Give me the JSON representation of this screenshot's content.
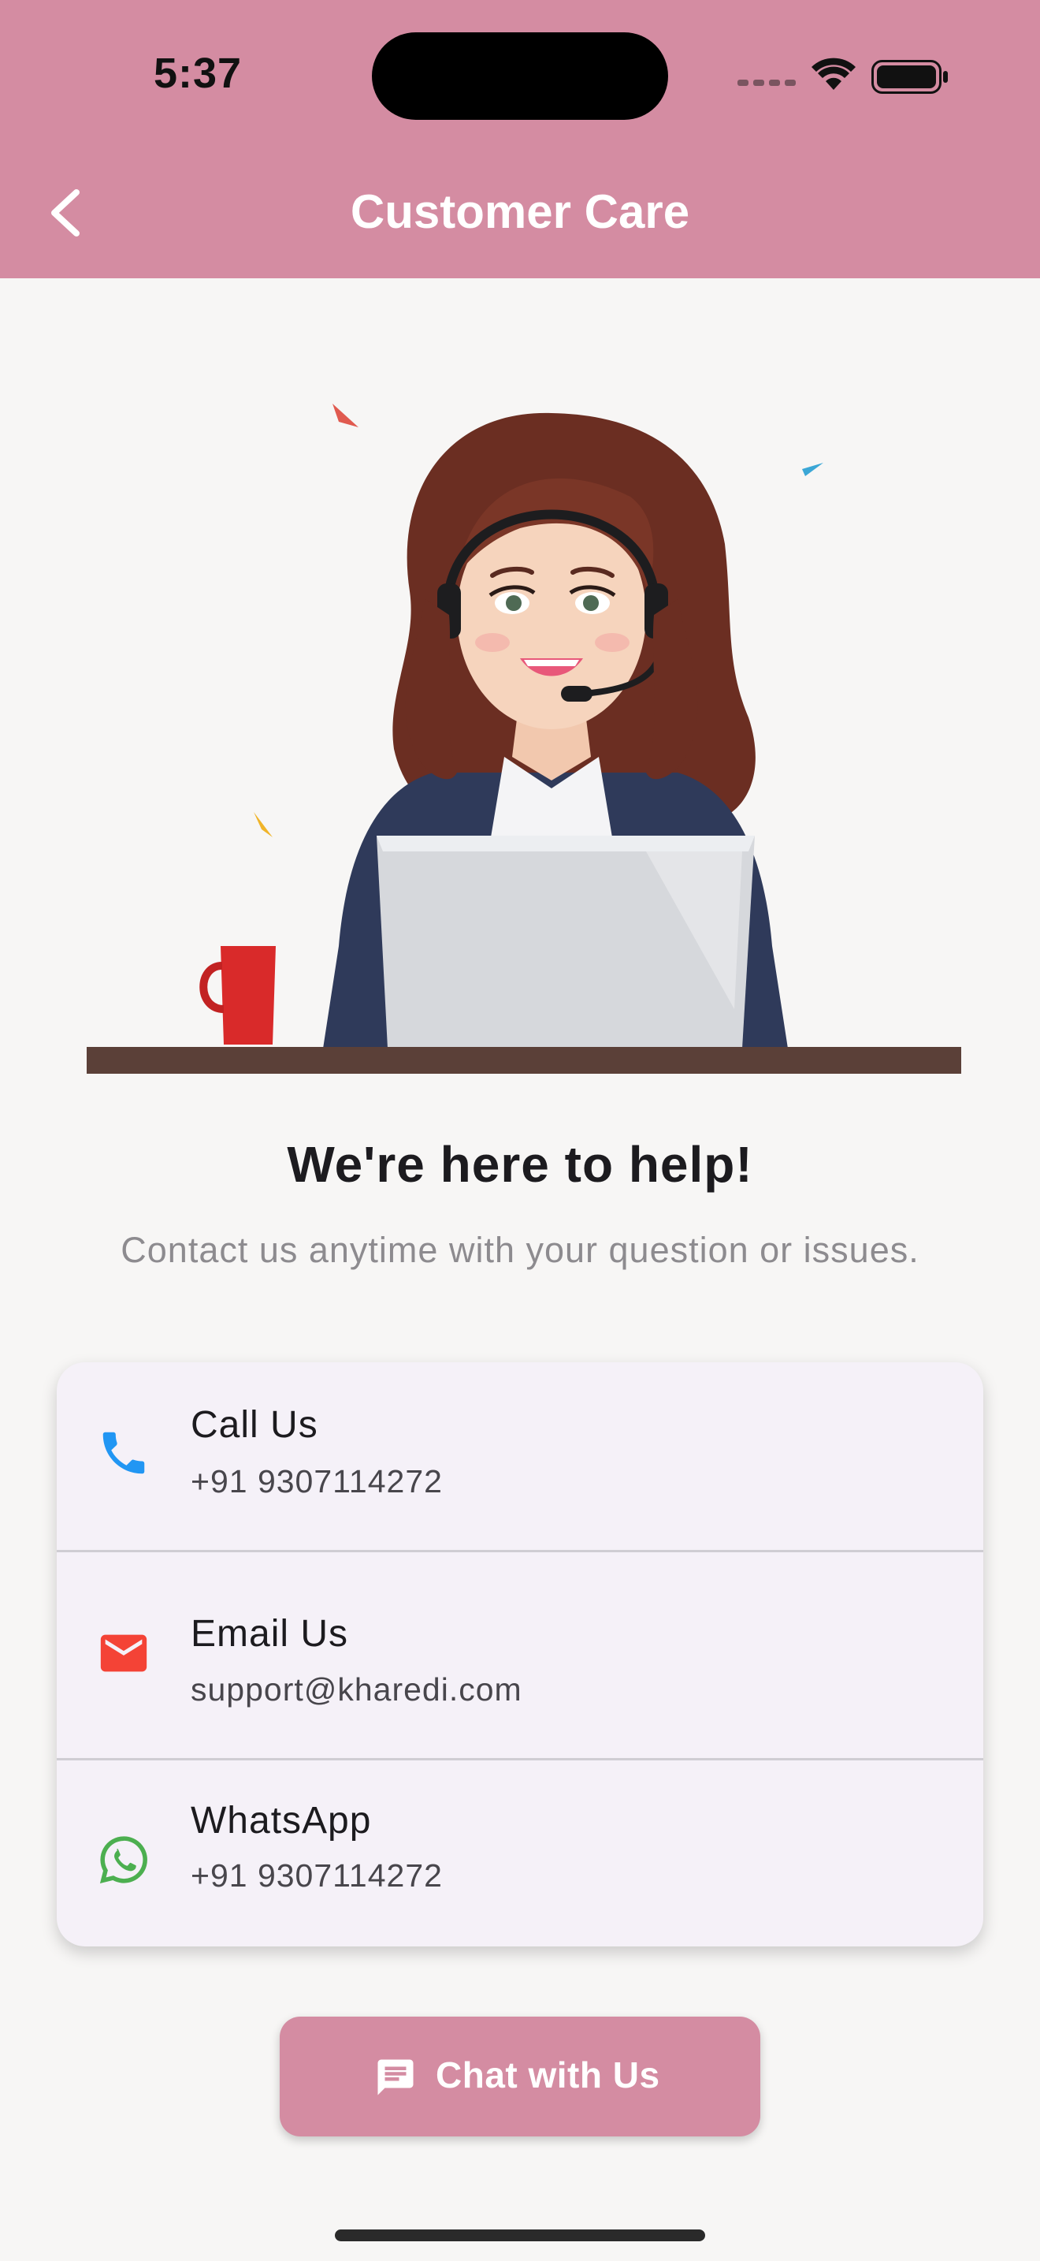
{
  "status_bar": {
    "time": "5:37"
  },
  "nav": {
    "title": "Customer Care",
    "back_icon": "chevron-left-icon"
  },
  "content": {
    "headline": "We're here to help!",
    "subtitle": "Contact us anytime with your question or issues."
  },
  "contacts": [
    {
      "title": "Call Us",
      "value": "+91 9307114272",
      "icon": "phone-icon",
      "icon_color": "#2196f3"
    },
    {
      "title": "Email Us",
      "value": "support@kharedi.com",
      "icon": "email-icon",
      "icon_color": "#f44336"
    },
    {
      "title": "WhatsApp",
      "value": "+91 9307114272",
      "icon": "whatsapp-icon",
      "icon_color": "#4caf50"
    }
  ],
  "chat_button": {
    "label": "Chat with Us",
    "icon": "chat-bubble-icon"
  },
  "colors": {
    "primary": "#d48ca2",
    "background": "#f7f6f5",
    "card": "#f5f1f8"
  }
}
